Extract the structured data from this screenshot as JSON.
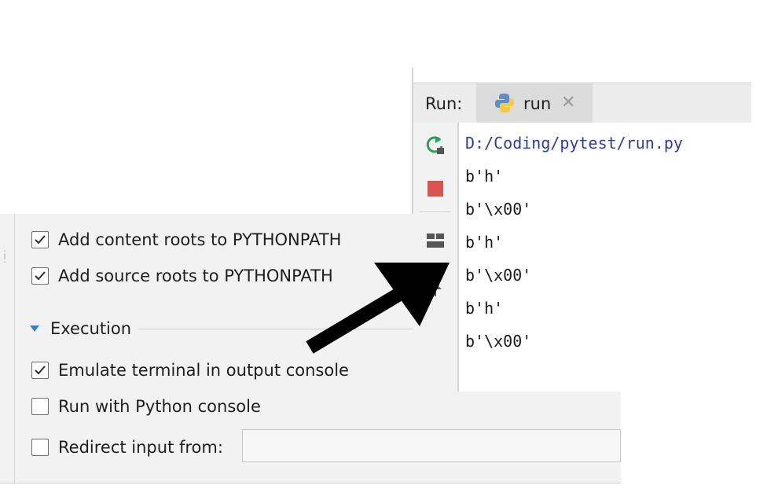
{
  "run_window": {
    "label": "Run:",
    "tab": {
      "name": "run",
      "icon": "python-icon",
      "close": "✕"
    },
    "toolbar": [
      "rerun-icon",
      "stop-icon",
      "layout-icon",
      "pin-icon"
    ],
    "console_lines": [
      "D:/Coding/pytest/run.py",
      "b'h'",
      "b'\\x00'",
      "b'h'",
      "b'\\x00'",
      "b'h'",
      "b'\\x00'"
    ]
  },
  "settings": {
    "options_top": [
      {
        "label": "Add content roots to PYTHONPATH",
        "checked": true
      },
      {
        "label": "Add source roots to PYTHONPATH",
        "checked": true
      }
    ],
    "section": {
      "label": "Execution",
      "expanded": true
    },
    "options_exec": [
      {
        "label": "Emulate terminal in output console",
        "checked": true
      },
      {
        "label": "Run with Python console",
        "checked": false
      },
      {
        "label": "Redirect input from:",
        "checked": false
      }
    ],
    "redirect_input_value": ""
  },
  "annotation": {
    "type": "arrow",
    "color": "#000000"
  },
  "colors": {
    "console_path": "#2a3f9e",
    "stop": "#d9534f",
    "rerun": "#2e9e5a",
    "section_arrow": "#3b7fc4"
  }
}
